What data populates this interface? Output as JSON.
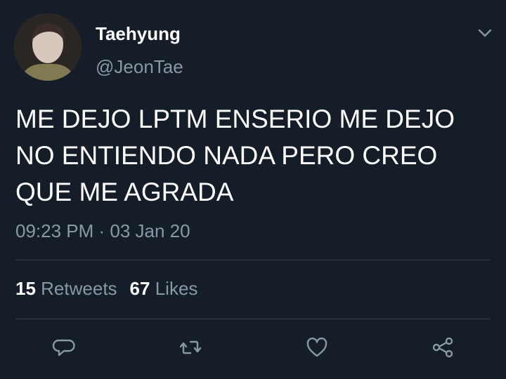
{
  "user": {
    "display_name": "Taehyung",
    "handle": "@JeonTae",
    "avatar": "profile-photo"
  },
  "tweet": {
    "text": "ME DEJO LPTM ENSERIO ME DEJO NO ENTIENDO NADA PERO CREO QUE ME AGRADA",
    "timestamp": "09:23 PM · 03 Jan 20"
  },
  "stats": {
    "retweets_count": "15",
    "retweets_label": "Retweets",
    "likes_count": "67",
    "likes_label": "Likes"
  },
  "actions": [
    "reply-icon",
    "retweet-icon",
    "like-icon",
    "share-icon"
  ],
  "colors": {
    "background": "#151d28",
    "text_primary": "#ffffff",
    "text_secondary": "#8899a6",
    "divider": "#2f3b48"
  }
}
